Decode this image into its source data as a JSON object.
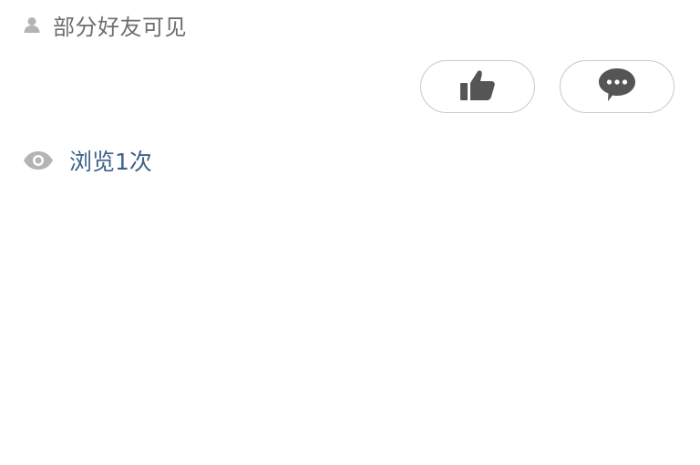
{
  "visibility": {
    "icon": "person-icon",
    "label": "部分好友可见"
  },
  "actions": {
    "like_icon": "thumbs-up-icon",
    "comment_icon": "comment-bubble-icon"
  },
  "views": {
    "icon": "eye-icon",
    "label": "浏览1次"
  },
  "colors": {
    "icon_gray": "#555555",
    "muted_gray": "#b4b4b4",
    "link_blue": "#3d6289",
    "border": "#c9c9c9"
  }
}
